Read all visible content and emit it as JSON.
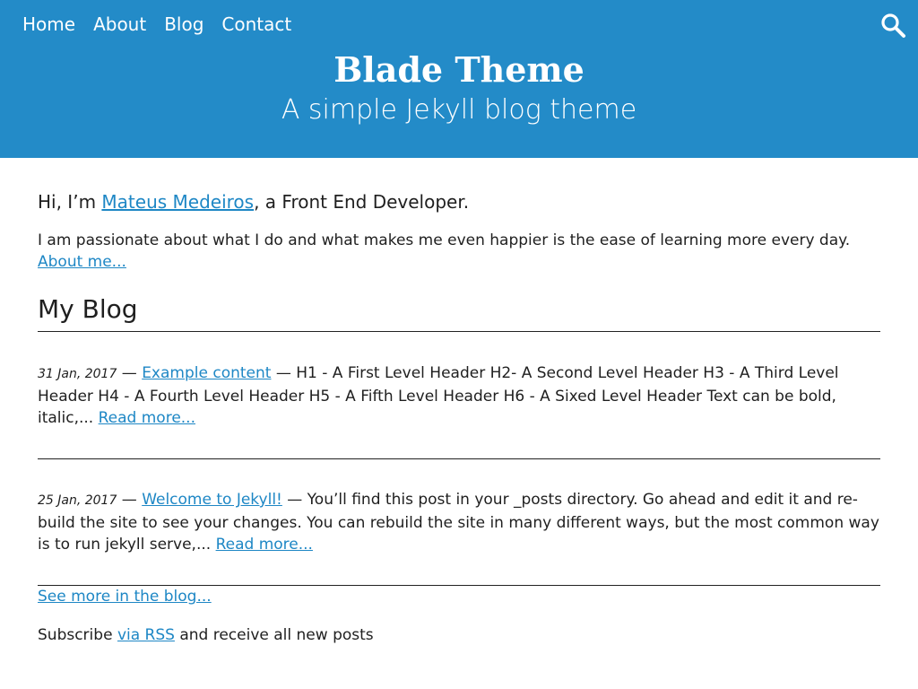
{
  "nav": {
    "items": [
      "Home",
      "About",
      "Blog",
      "Contact"
    ],
    "search_icon": "search-icon"
  },
  "header": {
    "title": "Blade Theme",
    "tagline": "A simple Jekyll blog theme",
    "background_color": "#238bc8"
  },
  "intro": {
    "greeting_prefix": "Hi, I’m ",
    "author_name": "Mateus Medeiros",
    "greeting_suffix": ", a Front End Developer.",
    "text": "I am passionate about what I do and what makes me even happier is the ease of learning more every day.",
    "about_link": "About me..."
  },
  "blog": {
    "heading": "My Blog",
    "separator": " — ",
    "posts": [
      {
        "date": "31 Jan, 2017",
        "title": "Example content",
        "excerpt": "H1 - A First Level Header H2- A Second Level Header H3 - A Third Level Header H4 - A Fourth Level Header H5 - A Fifth Level Header H6 - A Sixed Level Header Text can be bold, italic,...",
        "read_more": "Read more..."
      },
      {
        "date": "25 Jan, 2017",
        "title": "Welcome to Jekyll!",
        "excerpt": "You’ll find this post in your _posts directory. Go ahead and edit it and re-build the site to see your changes. You can rebuild the site in many different ways, but the most common way is to run jekyll serve,...",
        "read_more": "Read more..."
      }
    ],
    "see_more": "See more in the blog..."
  },
  "subscribe": {
    "prefix": "Subscribe ",
    "link": "via RSS",
    "suffix": " and receive all new posts"
  },
  "link_color": "#1e87c5"
}
